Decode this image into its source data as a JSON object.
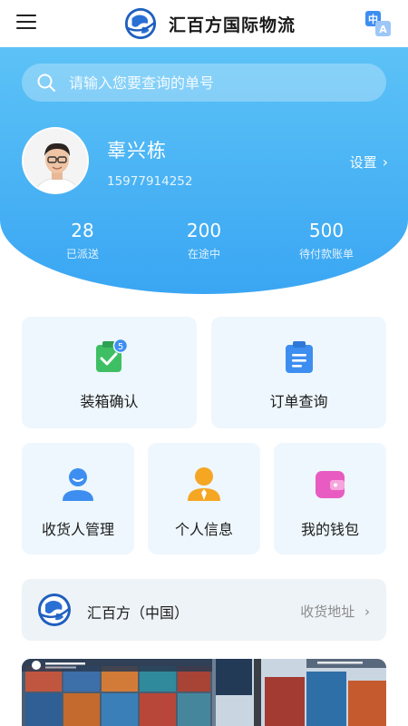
{
  "header": {
    "app_title": "汇百方国际物流",
    "menu_icon": "hamburger-menu-icon",
    "language_icon": "translate-zh-a-icon"
  },
  "search": {
    "placeholder": "请输入您要查询的单号",
    "icon": "search-icon"
  },
  "profile": {
    "name": "辜兴栋",
    "phone": "15977914252",
    "settings_label": "设置",
    "settings_chevron": "›"
  },
  "stats": [
    {
      "value": "28",
      "label": "已派送"
    },
    {
      "value": "200",
      "label": "在途中"
    },
    {
      "value": "500",
      "label": "待付款账单"
    }
  ],
  "actions": [
    {
      "label": "装箱确认",
      "icon": "clipboard-check-icon",
      "badge": "5"
    },
    {
      "label": "订单查询",
      "icon": "clipboard-list-icon"
    },
    {
      "label": "收货人管理",
      "icon": "person-icon"
    },
    {
      "label": "个人信息",
      "icon": "person-tie-icon"
    },
    {
      "label": "我的钱包",
      "icon": "wallet-icon"
    }
  ],
  "company": {
    "name": "汇百方（中国）",
    "address_link": "收货地址",
    "chevron": "›"
  },
  "colors": {
    "hero_top": "#5cc2f6",
    "hero_bottom": "#3aa6f3",
    "card_bg": "#eef7fd",
    "icon_blue": "#3d8ef0",
    "icon_green": "#3fbf63",
    "icon_orange": "#f5a623",
    "icon_pink": "#e85cc2"
  }
}
